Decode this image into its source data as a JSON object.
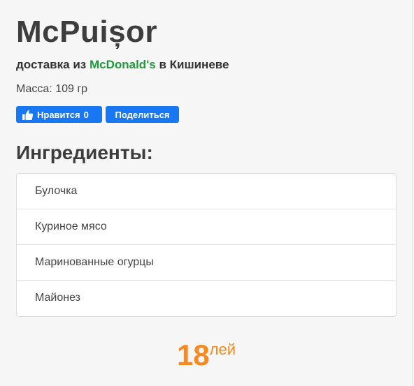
{
  "product": {
    "title": "McPuișor",
    "subtitle_prefix": "доставка из",
    "brand": "McDonald's",
    "subtitle_suffix": "в Кишиневе",
    "mass": "Масса: 109 гр"
  },
  "social": {
    "like_label": "Нравится",
    "like_count": "0",
    "share_label": "Поделиться",
    "button_color": "#1877f2",
    "like_icon": "thumbs-up-icon"
  },
  "ingredients": {
    "heading": "Ингредиенты:",
    "items": [
      "Булочка",
      "Куриное мясо",
      "Маринованные огурцы",
      "Майонез"
    ]
  },
  "price": {
    "amount": "18",
    "currency": "лей",
    "color": "#f7891f"
  },
  "colors": {
    "brand_green": "#1e9a3c",
    "background": "#f6f6f6"
  }
}
